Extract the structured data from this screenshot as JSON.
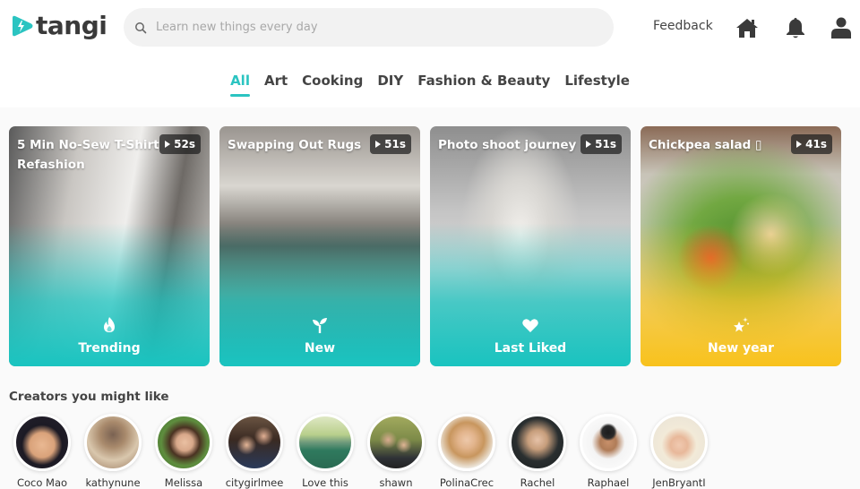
{
  "header": {
    "logo_text": "tangi",
    "search_placeholder": "Learn new things every day",
    "feedback_label": "Feedback",
    "icons": [
      "home-icon",
      "bell-icon",
      "user-icon"
    ],
    "accent_color": "#2bc4c1"
  },
  "tabs": [
    {
      "label": "All",
      "active": true
    },
    {
      "label": "Art",
      "active": false
    },
    {
      "label": "Cooking",
      "active": false
    },
    {
      "label": "DIY",
      "active": false
    },
    {
      "label": "Fashion & Beauty",
      "active": false
    },
    {
      "label": "Lifestyle",
      "active": false
    }
  ],
  "cards": [
    {
      "title": "5 Min No-Sew T-Shirt Refashion",
      "duration": "52s",
      "label": "Trending",
      "icon": "fire-icon",
      "theme": "teal"
    },
    {
      "title": "Swapping Out Rugs",
      "duration": "51s",
      "label": "New",
      "icon": "sprout-icon",
      "theme": "teal"
    },
    {
      "title": "Photo shoot journey",
      "duration": "51s",
      "label": "Last Liked",
      "icon": "heart-icon",
      "theme": "teal"
    },
    {
      "title": "Chickpea salad ▯",
      "duration": "41s",
      "label": "New year",
      "icon": "sparkle-star-icon",
      "theme": "yellow"
    }
  ],
  "creators": {
    "title": "Creators you might like",
    "items": [
      {
        "name": "Coco Mao"
      },
      {
        "name": "kathynune"
      },
      {
        "name": "Melissa"
      },
      {
        "name": "citygirlmee"
      },
      {
        "name": "Love this"
      },
      {
        "name": "shawn"
      },
      {
        "name": "PolinaCrec"
      },
      {
        "name": "Rachel"
      },
      {
        "name": "Raphael"
      },
      {
        "name": "JenBryantI"
      }
    ]
  }
}
